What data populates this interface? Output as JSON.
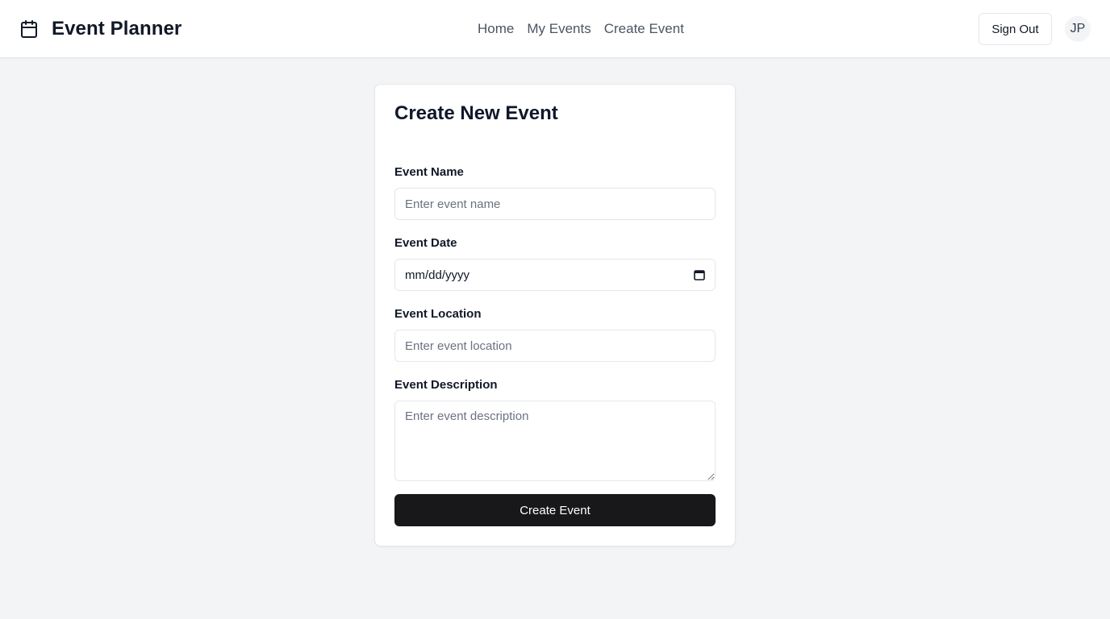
{
  "header": {
    "title": "Event Planner",
    "brand_icon": "calendar-icon",
    "nav": [
      "Home",
      "My Events",
      "Create Event"
    ],
    "sign_out_label": "Sign Out",
    "avatar_initials": "JP"
  },
  "form": {
    "title": "Create New Event",
    "fields": {
      "name": {
        "label": "Event Name",
        "placeholder": "Enter event name"
      },
      "date": {
        "label": "Event Date",
        "value": "mm/dd/yyyy",
        "icon": "calendar-icon"
      },
      "location": {
        "label": "Event Location",
        "placeholder": "Enter event location"
      },
      "description": {
        "label": "Event Description",
        "placeholder": "Enter event description"
      }
    },
    "submit_label": "Create Event"
  },
  "colors": {
    "page_bg": "#f3f4f6",
    "primary_button": "#18181b",
    "border": "#e5e7eb"
  }
}
